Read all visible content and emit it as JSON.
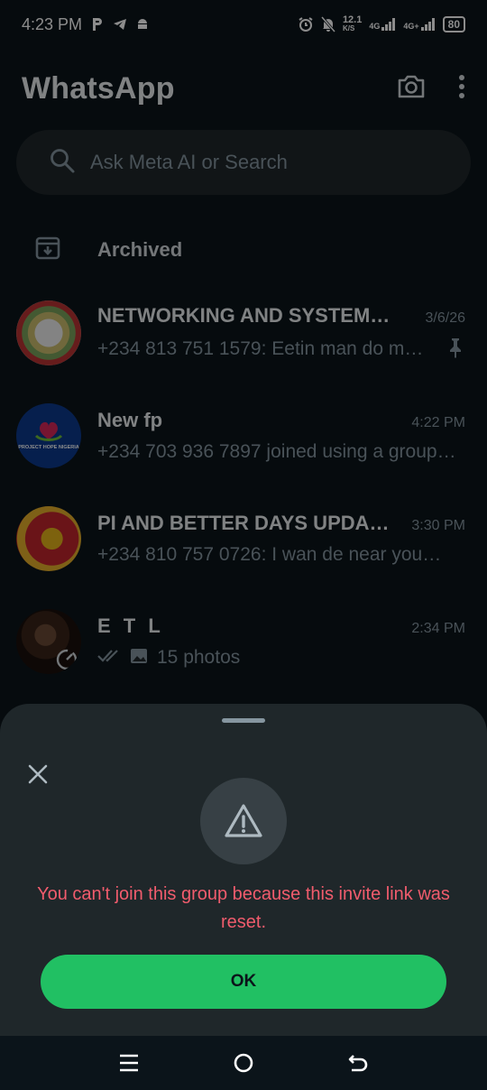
{
  "status_bar": {
    "time": "4:23 PM",
    "net_speed_value": "12.1",
    "net_speed_unit": "K/S",
    "network_1": "4G",
    "network_2": "4G+",
    "battery": "80",
    "left_icons": [
      "parking-icon",
      "telegram-icon",
      "android-icon"
    ],
    "right_icons": [
      "alarm-icon",
      "bell-off-icon"
    ]
  },
  "header": {
    "title": "WhatsApp",
    "icons": [
      "camera-icon",
      "more-vert-icon"
    ]
  },
  "search": {
    "placeholder": "Ask Meta AI or Search"
  },
  "archived": {
    "label": "Archived"
  },
  "chats": [
    {
      "name": "NETWORKING AND SYSTEM…",
      "time": "3/6/26",
      "message": "+234 813 751 1579: Eetin man do m…",
      "pinned": true
    },
    {
      "name": "New fp",
      "time": "4:22 PM",
      "message": "+234 703 936 7897 joined using a group…",
      "avatar_text": "PROJECT HOPE NIGERIA"
    },
    {
      "name": "PI AND BETTER DAYS UPDA…",
      "time": "3:30 PM",
      "message": "+234 810 757 0726: I wan de near you…"
    },
    {
      "name": "E T L",
      "time": "2:34 PM",
      "message": "15 photos",
      "status_icons": [
        "double-check-icon",
        "photo-icon",
        "status-ring-icon"
      ]
    }
  ],
  "dialog": {
    "message": "You can't join this group because this invite link was reset.",
    "ok_label": "OK",
    "icons": [
      "close-icon",
      "warning-icon"
    ]
  },
  "colors": {
    "background": "#0b141a",
    "surface": "#1f272a",
    "accent": "#21c063",
    "error": "#f15c6d",
    "secondary_text": "#8696a0"
  }
}
